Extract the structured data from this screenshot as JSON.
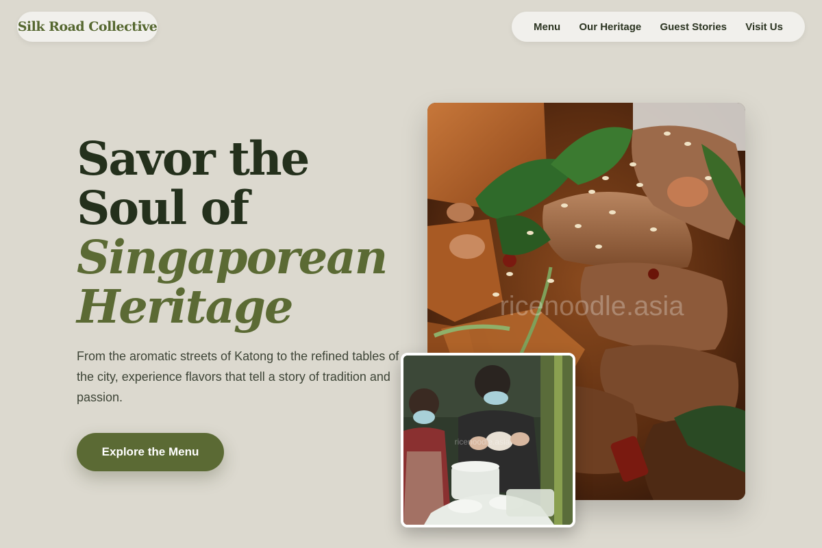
{
  "header": {
    "brand": "Silk Road Collective",
    "nav": [
      {
        "label": "Menu"
      },
      {
        "label": "Our Heritage"
      },
      {
        "label": "Guest Stories"
      },
      {
        "label": "Visit Us"
      }
    ]
  },
  "hero": {
    "title_line1": "Savor the",
    "title_line2": "Soul of",
    "title_accent1": "Singaporean",
    "title_accent2": "Heritage",
    "description": "From the aromatic streets of Katong to the refined tables of the city, experience flavors that tell a story of tradition and passion.",
    "cta_label": "Explore the Menu"
  },
  "images": {
    "main_watermark": "ricenoodle.asia",
    "inset_watermark": "ricenoodle.asia"
  },
  "colors": {
    "background": "#dcd9cf",
    "accent": "#5b6a34",
    "heading": "#24301c",
    "pill": "#f1f0ec"
  }
}
